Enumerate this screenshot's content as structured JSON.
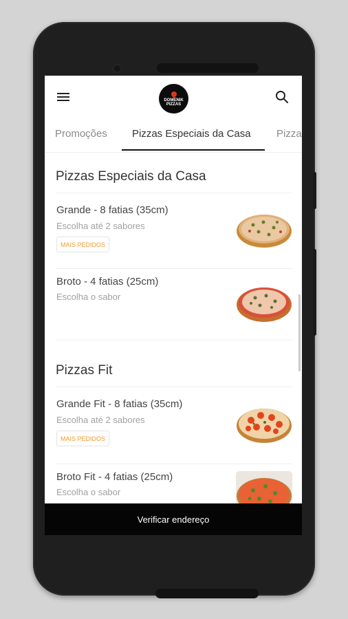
{
  "app": {
    "logo_text_top": "DOMENIK",
    "logo_text_bottom": "PIZZAS",
    "accent_color": "#f29a2e",
    "cta_background": "#050505"
  },
  "tabs": [
    {
      "label": "Promoções"
    },
    {
      "label": "Pizzas Especiais da Casa"
    },
    {
      "label": "Pizza"
    }
  ],
  "sections": [
    {
      "title": "Pizzas Especiais da Casa",
      "items": [
        {
          "title": "Grande - 8 fatias (35cm)",
          "subtitle": "Escolha até 2 sabores",
          "badge": "MAIS PEDIDOS"
        },
        {
          "title": "Broto - 4 fatias (25cm)",
          "subtitle": "Escolha o sabor"
        }
      ]
    },
    {
      "title": "Pizzas Fit",
      "items": [
        {
          "title": "Grande Fit - 8 fatias (35cm)",
          "subtitle": "Escolha até 2 sabores",
          "badge": "MAIS PEDIDOS"
        },
        {
          "title": "Broto Fit - 4 fatias (25cm)",
          "subtitle": "Escolha o sabor"
        }
      ]
    }
  ],
  "cta": {
    "label": "Verificar endereço"
  },
  "icons": {
    "menu": "hamburger-menu-icon",
    "search": "search-icon"
  }
}
